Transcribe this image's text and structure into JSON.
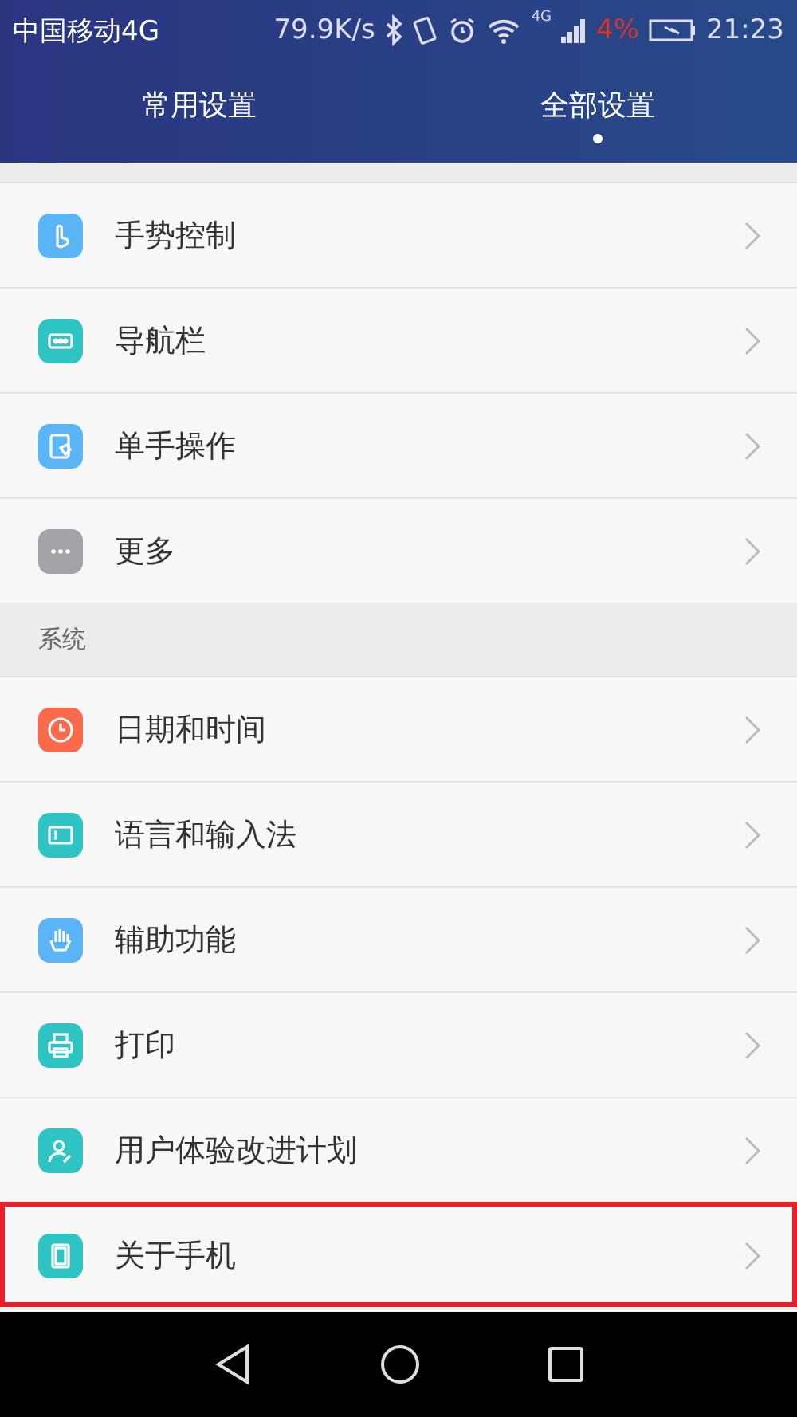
{
  "status_bar": {
    "carrier": "中国移动4G",
    "speed": "79.9K/s",
    "network": "4G",
    "battery": "4%",
    "time": "21:23"
  },
  "tabs": [
    {
      "label": "常用设置",
      "selected": false
    },
    {
      "label": "全部设置",
      "selected": true
    }
  ],
  "sections": [
    {
      "items": [
        {
          "label": "手势控制",
          "kind": "gesture",
          "color": "#5ab4f5",
          "highlighted": false
        },
        {
          "label": "导航栏",
          "kind": "navbar",
          "color": "#2ec4c4",
          "highlighted": false
        },
        {
          "label": "单手操作",
          "kind": "onehand",
          "color": "#5ab4f5",
          "highlighted": false
        },
        {
          "label": "更多",
          "kind": "more",
          "color": "#a3a3a8",
          "highlighted": false
        }
      ]
    },
    {
      "title": "系统",
      "items": [
        {
          "label": "日期和时间",
          "kind": "clock",
          "color": "#fa6a4b",
          "highlighted": false
        },
        {
          "label": "语言和输入法",
          "kind": "keyboard",
          "color": "#2ec4c4",
          "highlighted": false
        },
        {
          "label": "辅助功能",
          "kind": "hand",
          "color": "#5ab4f5",
          "highlighted": false
        },
        {
          "label": "打印",
          "kind": "printer",
          "color": "#2ec4c4",
          "highlighted": false
        },
        {
          "label": "用户体验改进计划",
          "kind": "user",
          "color": "#2ec4c4",
          "highlighted": false
        },
        {
          "label": "关于手机",
          "kind": "phone",
          "color": "#2ec4c4",
          "highlighted": true
        }
      ]
    }
  ]
}
